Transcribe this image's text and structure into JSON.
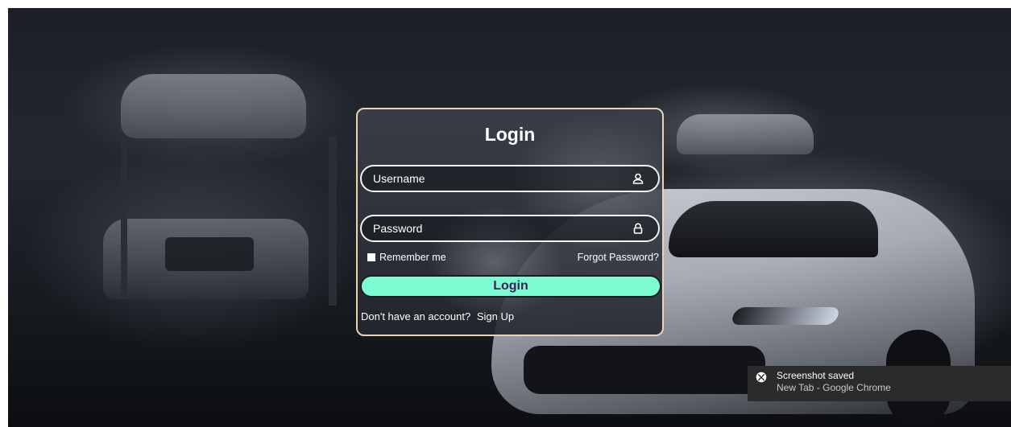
{
  "login": {
    "title": "Login",
    "username_placeholder": "Username",
    "password_placeholder": "Password",
    "remember_label": "Remember me",
    "forgot_label": "Forgot Password?",
    "submit_label": "Login",
    "signup_prompt": "Don't have an account?",
    "signup_link": "Sign Up",
    "username_icon": "user-icon",
    "password_icon": "lock-icon"
  },
  "toast": {
    "title": "Screenshot saved",
    "subtitle": "New Tab - Google Chrome",
    "icon": "xbox-icon"
  },
  "colors": {
    "accent_button": "#7dfbd3",
    "button_text": "#3a1f57",
    "card_border": "#e9d4b4"
  }
}
